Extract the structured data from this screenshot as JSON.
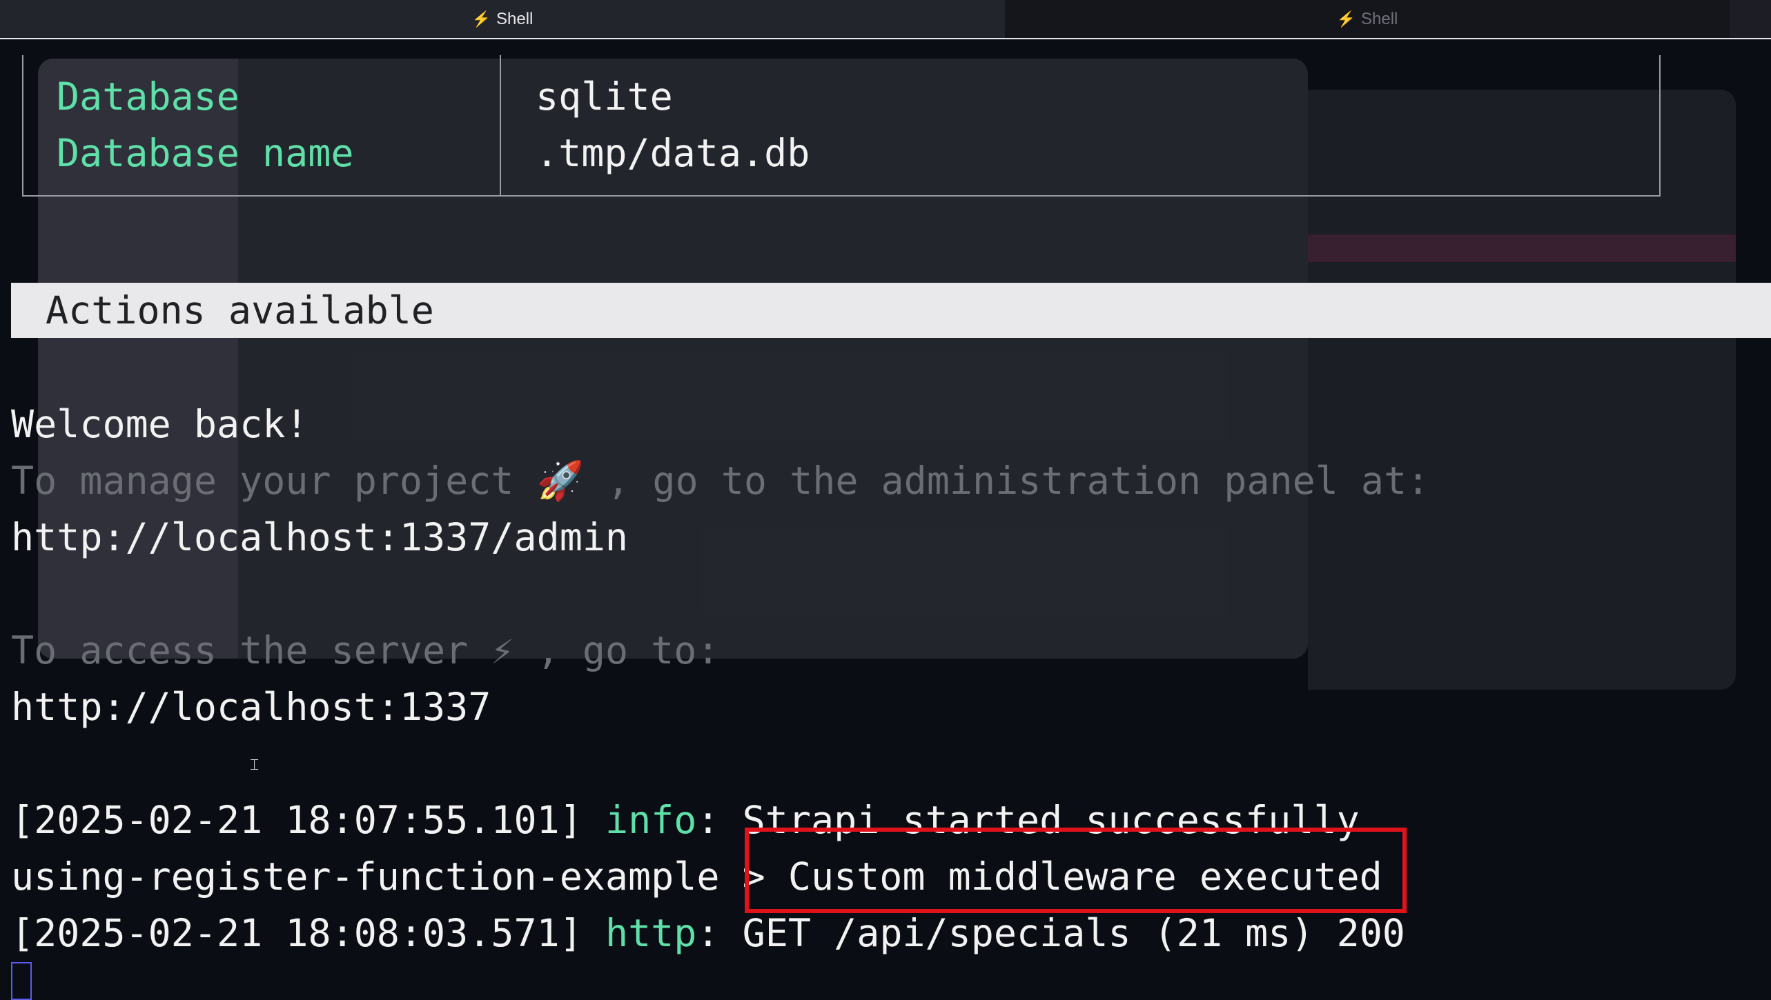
{
  "tabs": [
    {
      "label": "Shell",
      "active": true
    },
    {
      "label": "Shell",
      "active": false
    }
  ],
  "db_table": {
    "rows": [
      {
        "key": "Database",
        "value": "sqlite"
      },
      {
        "key": "Database name",
        "value": ".tmp/data.db"
      }
    ]
  },
  "banner": "Actions available",
  "welcome": "Welcome back!",
  "manage_prefix": "To manage your project ",
  "manage_suffix": " , go to the administration panel at:",
  "admin_url": "http://localhost:1337/admin",
  "access_prefix": "To access the server ",
  "access_suffix": " , go to:",
  "server_url": "http://localhost:1337",
  "log": [
    {
      "timestamp": "[2025-02-21 18:07:55.101]",
      "level": "info",
      "sep": ":",
      "message": " Strapi started successfully"
    },
    {
      "prefix": "using-register-function-example > ",
      "message": "Custom middleware executed"
    },
    {
      "timestamp": "[2025-02-21 18:08:03.571]",
      "level": "http",
      "sep": ":",
      "message": " GET /api/specials (21 ms) 200"
    }
  ],
  "icons": {
    "tab_icon": "bolt-icon",
    "rocket": "rocket-icon",
    "bolt": "lightning-icon"
  },
  "colors": {
    "accent_green": "#5fe0a8",
    "highlight_red": "#e0131c",
    "dim_text": "#6b6d74"
  }
}
